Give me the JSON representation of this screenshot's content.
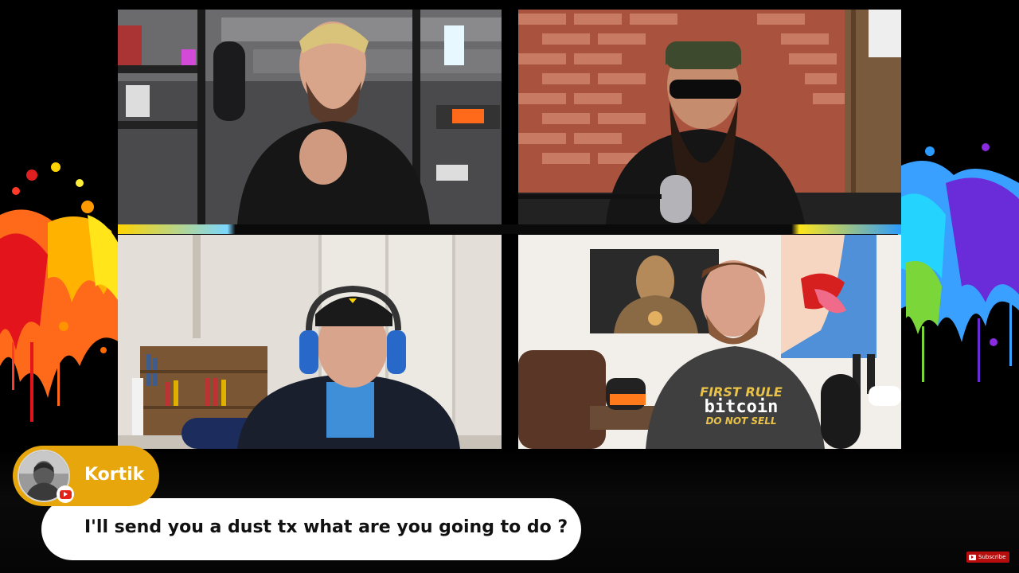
{
  "stream": {
    "participants": [
      {
        "tile": "top-left"
      },
      {
        "tile": "top-right"
      },
      {
        "tile": "bottom-left"
      },
      {
        "tile": "bottom-right"
      }
    ]
  },
  "chat": {
    "author": "Kortik",
    "platform_icon": "youtube-icon",
    "message": "I'll send you a dust tx what are you going to do ?"
  },
  "overlay": {
    "subscribe_label": "Subscribe"
  },
  "tshirt": {
    "line1": "FIRST RULE",
    "line2": "bitcoin",
    "line3": "DO NOT SELL"
  },
  "colors": {
    "name_pill": "#e7a70c",
    "bubble": "#ffffff",
    "background": "#000000",
    "youtube_red": "#e62117"
  }
}
